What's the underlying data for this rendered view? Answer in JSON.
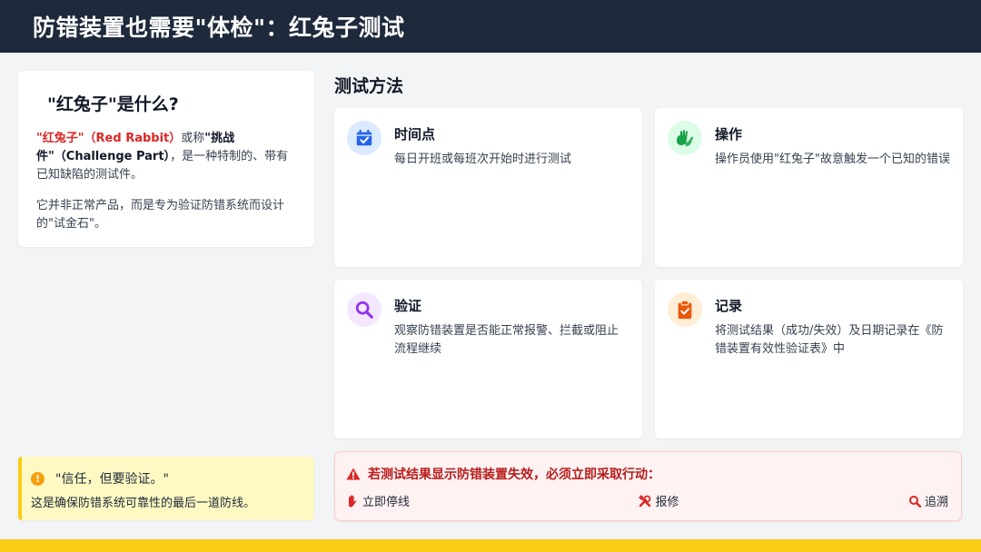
{
  "header": {
    "title": "防错装置也需要\"体检\"：红兔子测试"
  },
  "definition": {
    "title": "\"红兔子\"是什么?",
    "term_red": "\"红兔子\"（Red Rabbit）",
    "or_called": "或称",
    "term_bold": "\"挑战件\"（Challenge Part）",
    "desc_rest": "，是一种特制的、带有已知缺陷的测试件。",
    "para2": "它并非正常产品，而是专为验证防错系统而设计的\"试金石\"。"
  },
  "quote": {
    "icon": "exclamation-circle-icon",
    "line1": "\"信任，但要验证。\"",
    "line2": "这是确保防错系统可靠性的最后一道防线。"
  },
  "methods": {
    "section_title": "测试方法",
    "items": [
      {
        "title": "时间点",
        "desc": "每日开班或每班次开始时进行测试",
        "icon": "calendar-check-icon",
        "color": "#2563eb",
        "bg": "#dbeafe"
      },
      {
        "title": "操作",
        "desc": "操作员使用\"红兔子\"故意触发一个已知的错误",
        "icon": "hands-icon",
        "color": "#16a34a",
        "bg": "#dcfce7"
      },
      {
        "title": "验证",
        "desc": "观察防错装置是否能正常报警、拦截或阻止流程继续",
        "icon": "magnifier-icon",
        "color": "#9333ea",
        "bg": "#f3e8ff"
      },
      {
        "title": "记录",
        "desc": "将测试结果（成功/失效）及日期记录在《防错装置有效性验证表》中",
        "icon": "clipboard-check-icon",
        "color": "#ea580c",
        "bg": "#ffedd5"
      }
    ]
  },
  "alert": {
    "title": "若测试结果显示防错装置失效，必须立即采取行动：",
    "actions": [
      {
        "label": "立即停线",
        "icon": "hand-stop-icon"
      },
      {
        "label": "报修",
        "icon": "tools-icon"
      },
      {
        "label": "追溯",
        "icon": "search-icon"
      }
    ]
  },
  "colors": {
    "header_bg": "#1e293b",
    "accent_yellow": "#facc15",
    "alert_red": "#dc2626"
  }
}
